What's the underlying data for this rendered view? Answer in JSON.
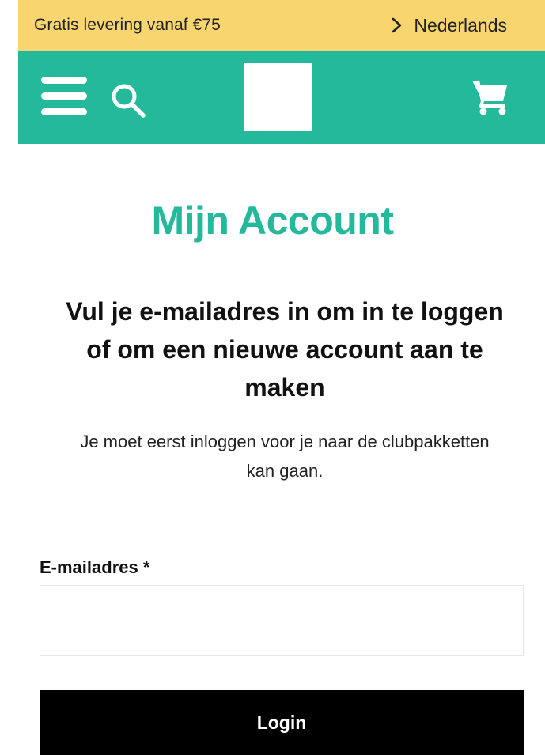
{
  "promo_bar": {
    "text": "Gratis levering vanaf €75",
    "language_label": "Nederlands",
    "language_icon": "chevron-right-icon",
    "background": "#f8d56f"
  },
  "header": {
    "background": "#24b99a",
    "menu_icon": "hamburger-menu-icon",
    "search_icon": "search-icon",
    "cart_icon": "shopping-cart-icon"
  },
  "main": {
    "title": "Mijn Account",
    "subtitle": "Vul je e-mailadres in om in te loggen of om een nieuwe account aan te maken",
    "notice": "Je moet eerst inloggen voor je naar de clubpakketten kan gaan.",
    "accent_color": "#24b99a"
  },
  "form": {
    "email_label": "E-mailadres *",
    "email_value": "",
    "email_placeholder": "",
    "login_label": "Login"
  }
}
